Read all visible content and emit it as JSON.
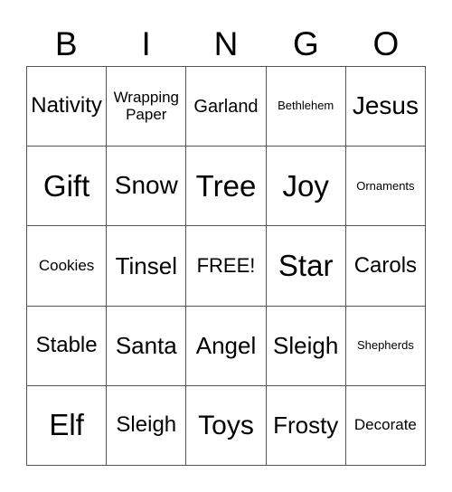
{
  "header": [
    "B",
    "I",
    "N",
    "G",
    "O"
  ],
  "cells": [
    "Nativity",
    "Wrapping Paper",
    "Garland",
    "Bethlehem",
    "Jesus",
    "Gift",
    "Snow",
    "Tree",
    "Joy",
    "Ornaments",
    "Cookies",
    "Tinsel",
    "FREE!",
    "Star",
    "Carols",
    "Stable",
    "Santa",
    "Angel",
    "Sleigh",
    "Shepherds",
    "Elf",
    "Sleigh",
    "Toys",
    "Frosty",
    "Decorate"
  ]
}
